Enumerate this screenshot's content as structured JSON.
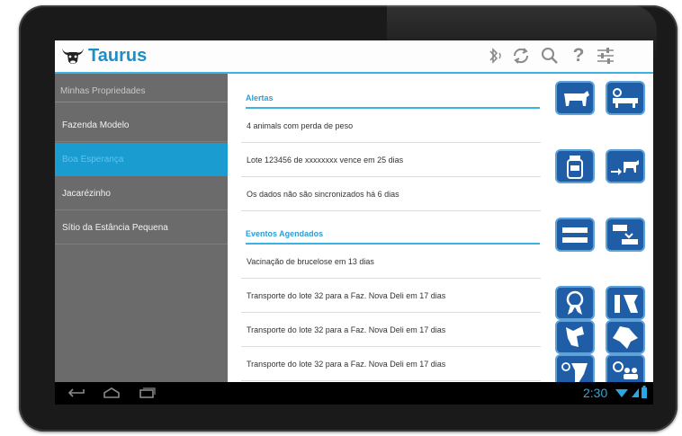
{
  "app": {
    "name": "Taurus"
  },
  "actionbar": {
    "icons": [
      "bluetooth-icon",
      "sync-icon",
      "search-icon",
      "help-icon",
      "settings-sliders-icon"
    ],
    "help_glyph": "?"
  },
  "sidebar": {
    "header": "Minhas Propriedades",
    "items": [
      {
        "label": "Fazenda Modelo",
        "active": false
      },
      {
        "label": "Boa Esperança",
        "active": true
      },
      {
        "label": "Jacarézinho",
        "active": false
      },
      {
        "label": "Sítio da Estância Pequena",
        "active": false
      }
    ]
  },
  "alerts": {
    "title": "Alertas",
    "items": [
      "4 animals com perda de peso",
      "Lote 123456 de xxxxxxxx vence em 25 dias",
      "Os dados não são sincronizados há 6 dias"
    ]
  },
  "events": {
    "title": "Eventos Agendados",
    "items": [
      "Vacinação de brucelose em 13 dias",
      "Transporte do lote 32 para a Faz. Nova Deli em 17 dias",
      "Transporte do lote 32 para a Faz. Nova Deli em 17 dias",
      "Transporte do lote 32 para a Faz. Nova Deli em 17 dias"
    ]
  },
  "tiles": [
    "cow-icon",
    "herd-search-icon",
    "medicine-icon",
    "cattle-transfer-icon",
    "cattle-group-icon",
    "cattle-split-icon",
    "award-ribbon-icon",
    "cow-outline-icon",
    "map-region-icon",
    "region-map-icon",
    "cow-head-icon",
    "people-search-icon"
  ],
  "statusbar": {
    "time": "2:30"
  },
  "colors": {
    "accent": "#3bb3e3",
    "tile": "#1f5ea6",
    "sidebar": "#6b6b6b",
    "active": "#1b9cd0"
  }
}
